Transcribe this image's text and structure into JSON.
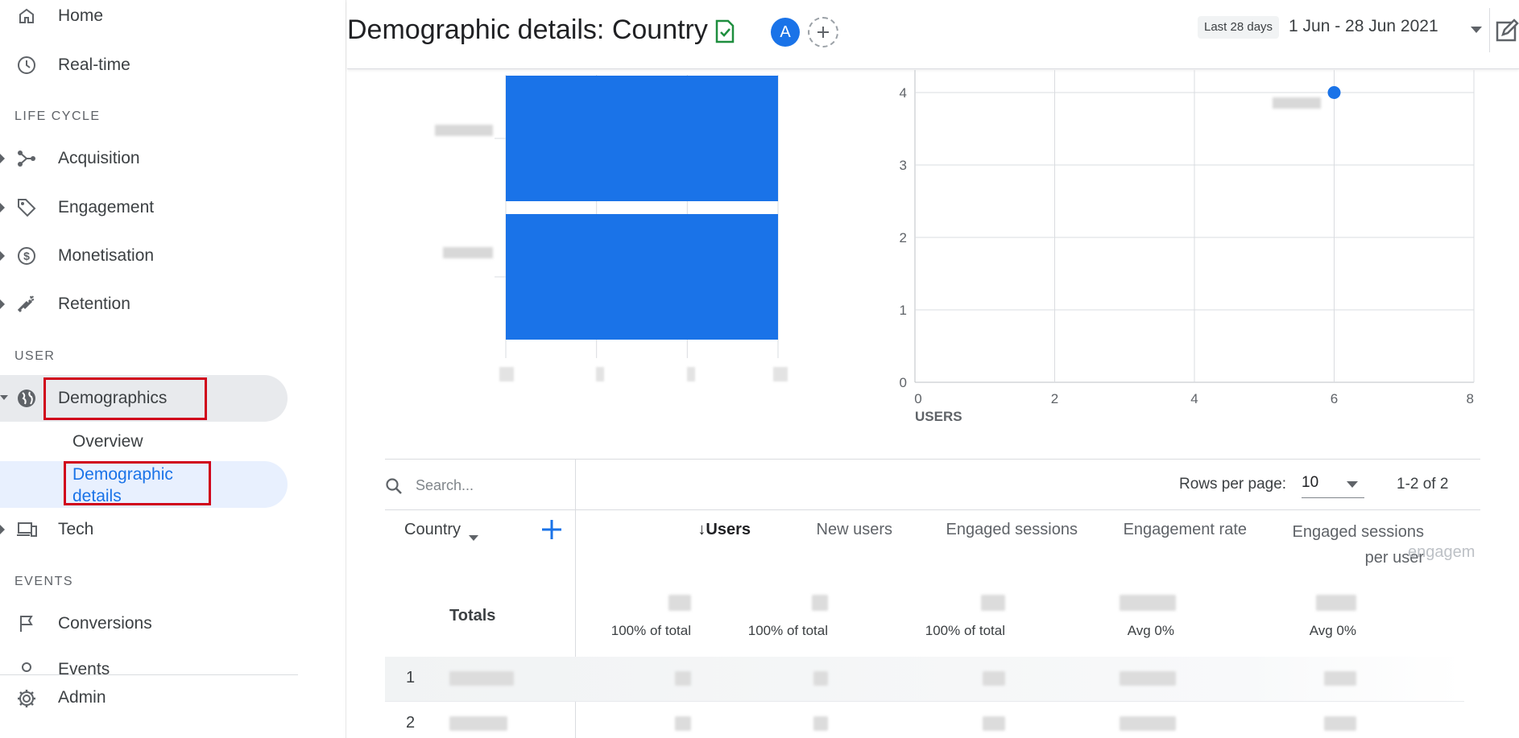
{
  "sidebar": {
    "items": [
      {
        "label": "Home",
        "icon": "home-icon"
      },
      {
        "label": "Real-time",
        "icon": "clock-icon"
      }
    ],
    "sections": {
      "lifecycle": "LIFE CYCLE",
      "user": "USER",
      "events": "EVENTS"
    },
    "lifecycle_items": [
      {
        "label": "Acquisition",
        "icon": "acquisition-icon"
      },
      {
        "label": "Engagement",
        "icon": "tag-icon"
      },
      {
        "label": "Monetisation",
        "icon": "dollar-icon"
      },
      {
        "label": "Retention",
        "icon": "magnet-icon"
      }
    ],
    "user_items": {
      "demographics": "Demographics",
      "overview": "Overview",
      "demographic_details_line1": "Demographic",
      "demographic_details_line2": "details",
      "tech": "Tech"
    },
    "events_items": {
      "conversions": "Conversions",
      "events": "Events"
    },
    "admin": "Admin"
  },
  "header": {
    "title": "Demographic details: Country",
    "avatar_letter": "A",
    "date_chip": "Last 28 days",
    "date_range": "1 Jun - 28 Jun 2021"
  },
  "scatter_chart": {
    "y_ticks": [
      "0",
      "1",
      "2",
      "3",
      "4"
    ],
    "x_ticks": [
      "0",
      "2",
      "4",
      "6",
      "8"
    ],
    "x_axis_title": "USERS"
  },
  "chart_data": [
    {
      "type": "bar",
      "orientation": "horizontal",
      "categories": [
        "",
        ""
      ],
      "values": [
        3,
        3
      ],
      "xlim": [
        0,
        3
      ],
      "color": "#1a73e8"
    },
    {
      "type": "scatter",
      "x": [
        6
      ],
      "y": [
        4
      ],
      "xlim": [
        0,
        8
      ],
      "ylim": [
        0,
        4
      ],
      "xlabel": "USERS",
      "color": "#1a73e8",
      "grid": true
    }
  ],
  "table": {
    "search_placeholder": "Search...",
    "rows_per_page_label": "Rows per page:",
    "rows_per_page_value": "10",
    "pagination": "1-2 of 2",
    "columns": {
      "country": "Country",
      "users": "Users",
      "new_users": "New users",
      "engaged_sessions": "Engaged sessions",
      "engagement_rate": "Engagement rate",
      "engaged_per_user_line1": "Engaged sessions",
      "engaged_per_user_line2": "per user",
      "extra": "engagem"
    },
    "totals": {
      "label": "Totals",
      "users_pct": "100% of total",
      "new_users_pct": "100% of total",
      "engaged_pct": "100% of total",
      "rate_avg": "Avg 0%",
      "spu_avg": "Avg 0%"
    },
    "rows": [
      {
        "index": "1"
      },
      {
        "index": "2"
      }
    ]
  },
  "colors": {
    "accent": "#1a73e8",
    "highlight_box": "#d0021b",
    "active_bg": "#e8f0fe",
    "badge_green": "#1e8e3e"
  }
}
